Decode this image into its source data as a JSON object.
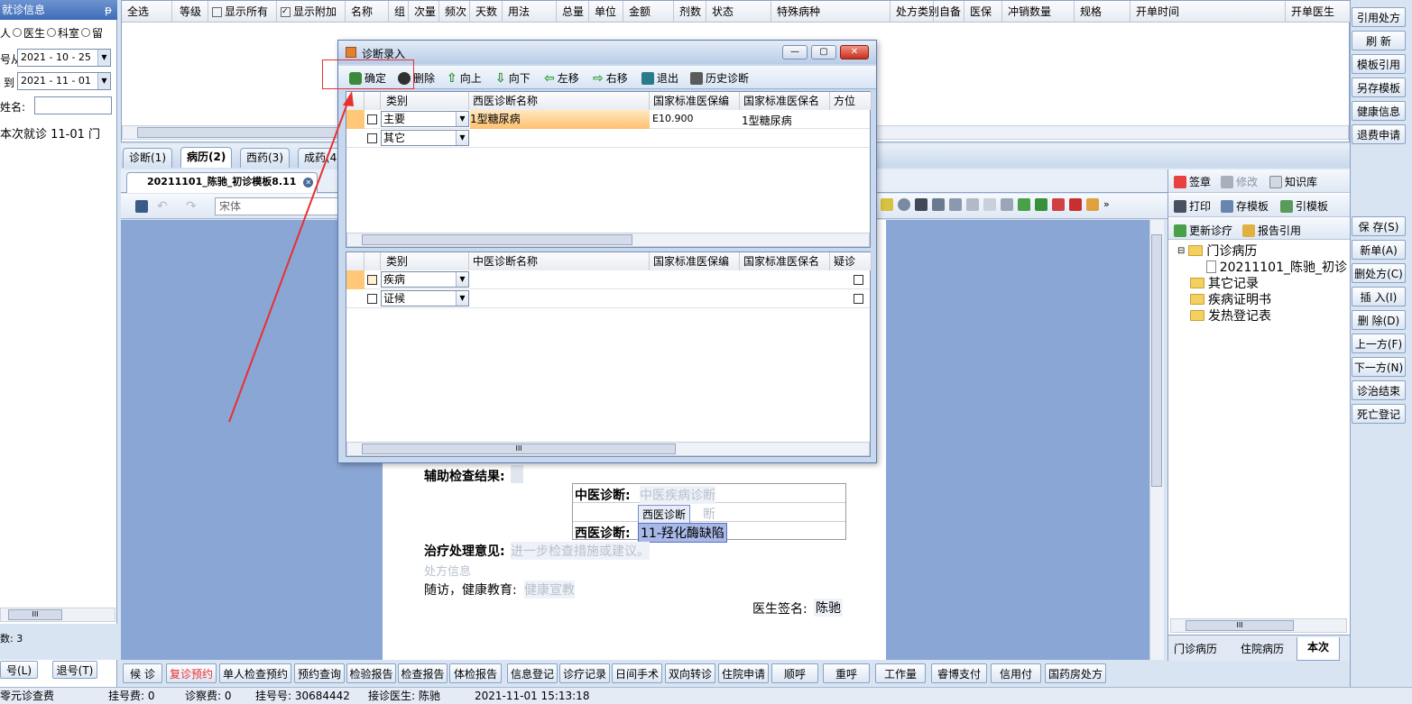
{
  "left_panel": {
    "title": "就诊信息",
    "pin": "ᵽ",
    "radio_patient": "人",
    "radio_doctor": "医生",
    "radio_dept": "科室",
    "radio_stay": "留",
    "date_from_label": "号从",
    "date_from": "2021 - 10 - 25",
    "date_to_label": "到",
    "date_to": "2021 - 11 - 01",
    "name_label": "姓名:",
    "name_value": "",
    "visit_row": "本次就诊  11-01  门",
    "scroll_thumb": "III",
    "count_label": "数: 3",
    "btn_register": "号(L)",
    "btn_unregister": "退号(T)"
  },
  "rx_grid": {
    "headers": [
      "全选",
      "等级",
      "显示所有",
      "显示附加",
      "名称",
      "组",
      "次量",
      "频次",
      "天数",
      "用法",
      "总量",
      "单位",
      "金额",
      "剂数",
      "状态",
      "特殊病种",
      "处方类别",
      "自备",
      "医保",
      "冲销数量",
      "规格",
      "开单时间",
      "开单医生"
    ]
  },
  "tabs": {
    "items": [
      "诊断(1)",
      "病历(2)",
      "西药(3)",
      "成药(4)"
    ],
    "doc_tab": "20211101_陈驰_初诊模板8.11",
    "font_name": "宋体"
  },
  "record": {
    "aux_label": "辅助检查结果:",
    "tcm_label": "中医诊断:",
    "tcm_placeholder": "中医疾病诊断",
    "wm_chip": "西医诊断",
    "wm_chip_trail": "断",
    "wm_label": "西医诊断:",
    "wm_value": "11-羟化酶缺陷",
    "treat_label": "治疗处理意见:",
    "treat_placeholder": "进一步检查措施或建议。",
    "rx_info": "处方信息",
    "followup_label": "随访，健康教育:",
    "followup_placeholder": "健康宣教",
    "sign_label": "医生签名:",
    "sign_value": "陈驰"
  },
  "dialog": {
    "title": "诊断录入",
    "toolbar": [
      "确定",
      "删除",
      "向上",
      "向下",
      "左移",
      "右移",
      "退出",
      "历史诊断"
    ],
    "wm_headers": [
      "类别",
      "西医诊断名称",
      "国家标准医保编",
      "国家标准医保名",
      "方位"
    ],
    "wm_rows": [
      {
        "category": "主要",
        "name": "1型糖尿病",
        "code": "E10.900",
        "std_name": "1型糖尿病"
      },
      {
        "category": "其它",
        "name": "",
        "code": "",
        "std_name": ""
      }
    ],
    "tcm_headers": [
      "类别",
      "中医诊断名称",
      "国家标准医保编",
      "国家标准医保名",
      "疑诊"
    ],
    "tcm_rows": [
      {
        "category": "疾病",
        "name": "",
        "code": "",
        "std_name": ""
      },
      {
        "category": "证候",
        "name": "",
        "code": "",
        "std_name": ""
      }
    ],
    "scroll_thumb": "III"
  },
  "right_tools": {
    "row1": [
      "签章",
      "修改",
      "知识库"
    ],
    "row2": [
      "打印",
      "存模板",
      "引模板"
    ],
    "row3": [
      "更新诊疗",
      "报告引用"
    ],
    "tree": [
      "门诊病历",
      "20211101_陈驰_初诊",
      "其它记录",
      "疾病证明书",
      "发热登记表"
    ],
    "bottom_tabs": [
      "门诊病历",
      "住院病历",
      "本次"
    ],
    "scroll_thumb": "III"
  },
  "right_buttons": [
    "引用处方",
    "刷 新",
    "模板引用",
    "另存模板",
    "健康信息",
    "退费申请",
    "保 存(S)",
    "新单(A)",
    "删处方(C)",
    "插 入(I)",
    "删 除(D)",
    "上一方(F)",
    "下一方(N)",
    "诊治结束",
    "死亡登记"
  ],
  "bottom_buttons": [
    "候 诊",
    "复诊预约",
    "单人检查预约",
    "预约查询",
    "检验报告",
    "检查报告",
    "体检报告",
    "信息登记",
    "诊疗记录",
    "日间手术",
    "双向转诊",
    "住院申请",
    "顺呼",
    "重呼",
    "工作量",
    "睿博支付",
    "信用付",
    "国药房处方"
  ],
  "status": {
    "left": "零元诊查费",
    "reg_fee": "挂号费:  0",
    "diag_fee": "诊察费:  0",
    "reg_no": "挂号号:  30684442",
    "doctor": "接诊医生:  陈驰",
    "time": "2021-11-01 15:13:18"
  },
  "colors": {
    "accent_red": "#e83030",
    "highlight": "#ffc878",
    "panel_blue": "#8aa6d4"
  }
}
